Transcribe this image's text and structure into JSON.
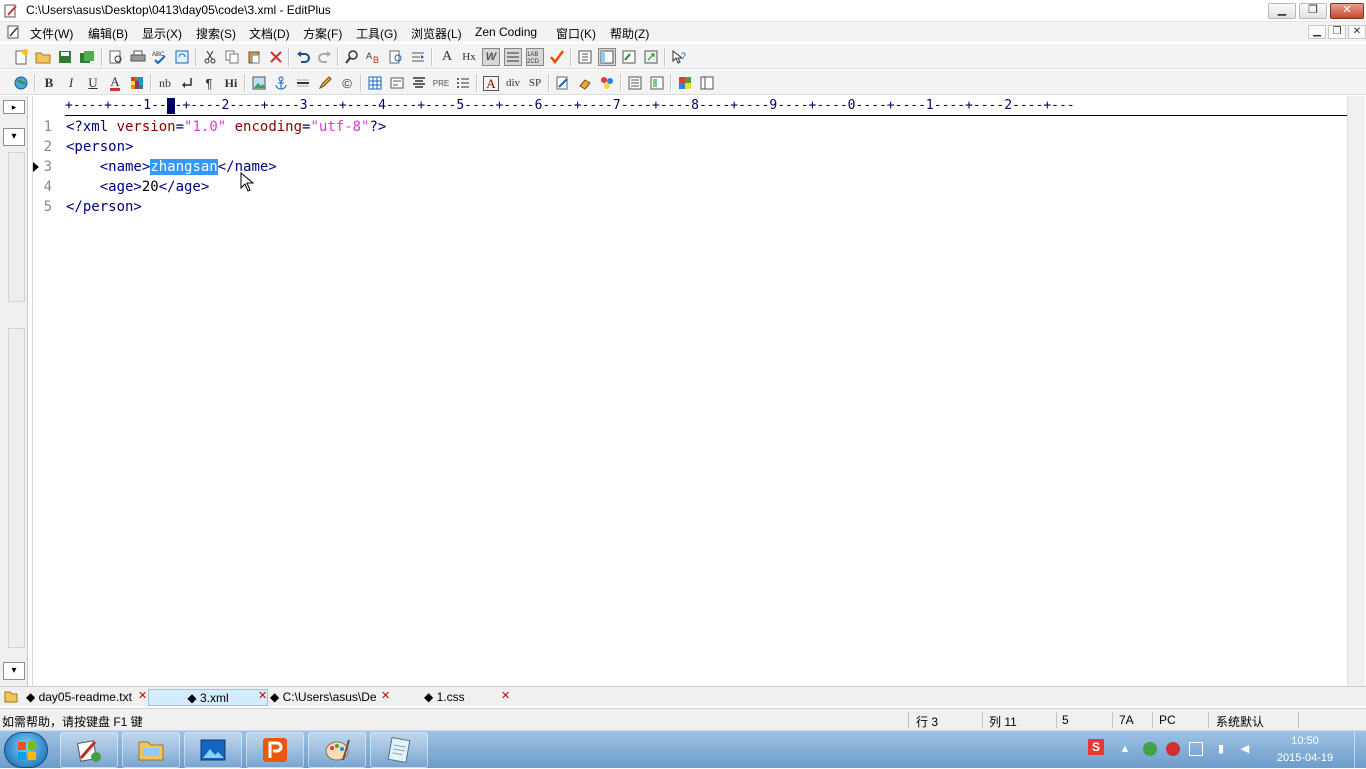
{
  "window": {
    "title": "C:\\Users\\asus\\Desktop\\0413\\day05\\code\\3.xml - EditPlus",
    "min_glyph": "▁",
    "max_glyph": "❐",
    "close_glyph": "✕"
  },
  "menu": {
    "items": [
      "文件(W)",
      "编辑(B)",
      "显示(X)",
      "搜索(S)",
      "文档(D)",
      "方案(F)",
      "工具(G)",
      "浏览器(L)",
      "Zen Coding",
      "窗口(K)",
      "帮助(Z)"
    ]
  },
  "toolbar2": {
    "bold": "B",
    "italic": "I",
    "underline": "U",
    "font_color": "A",
    "nbsp": "nb",
    "paragraph": "¶",
    "heading": "Hi",
    "pre": "PRE",
    "div": "div",
    "span": "SP",
    "copyright": "©"
  },
  "toolbar1": {
    "font_a": "A",
    "hx": "Hx",
    "word_wrap": "W"
  },
  "ruler": "+----+----1----+----2----+----3----+----4----+----5----+----6----+----7----+----8----+----9----+----0----+----1----+----2----+---",
  "editor": {
    "lines": [
      {
        "num": "1",
        "parts": [
          {
            "t": "<?xml ",
            "c": "tag"
          },
          {
            "t": "version",
            "c": "attr"
          },
          {
            "t": "=",
            "c": "tag"
          },
          {
            "t": "\"1.0\" ",
            "c": "str"
          },
          {
            "t": "encoding",
            "c": "attr"
          },
          {
            "t": "=",
            "c": "tag"
          },
          {
            "t": "\"utf-8\"",
            "c": "str"
          },
          {
            "t": "?>",
            "c": "tag"
          }
        ]
      },
      {
        "num": "2",
        "parts": [
          {
            "t": "<person>",
            "c": "tag"
          }
        ]
      },
      {
        "num": "3",
        "parts": [
          {
            "t": "    <name>",
            "c": "tag"
          },
          {
            "t": "zhangsan",
            "c": "sel"
          },
          {
            "t": "</name>",
            "c": "tag"
          }
        ]
      },
      {
        "num": "4",
        "parts": [
          {
            "t": "    <age>",
            "c": "tag"
          },
          {
            "t": "20",
            "c": "txt"
          },
          {
            "t": "</age>",
            "c": "tag"
          }
        ]
      },
      {
        "num": "5",
        "parts": [
          {
            "t": "</person>",
            "c": "tag"
          }
        ]
      }
    ]
  },
  "tabs": [
    {
      "label": "day05-readme.txt",
      "active": false
    },
    {
      "label": "3.xml",
      "active": true
    },
    {
      "label": "C:\\Users\\asus\\De",
      "active": false
    },
    {
      "label": "1.css",
      "active": false
    }
  ],
  "status": {
    "help": "如需帮助，请按键盘 F1 键",
    "row": "行 3",
    "col": "列 11",
    "lines": "5",
    "hex": "7A",
    "eol": "PC",
    "encoding": "系统默认"
  },
  "taskbar": {
    "time": "10:50",
    "date": "2015-04-19",
    "ime": "S"
  },
  "colors": {
    "tag": "#00007f",
    "attr": "#8b0000",
    "string": "#d63bd6",
    "selection": "#3399ff",
    "ruler": "#00006a"
  }
}
